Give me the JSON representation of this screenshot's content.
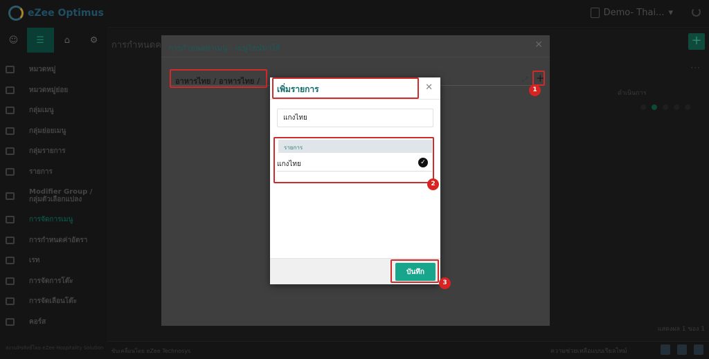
{
  "app": {
    "logo_text": "eZee Optimus"
  },
  "topbar": {
    "property_name": "Demo- Thai...",
    "caret": "▾"
  },
  "sidebar": {
    "items": [
      {
        "label": "หมวดหมู่"
      },
      {
        "label": "หมวดหมู่ย่อย"
      },
      {
        "label": "กลุ่มเมนู"
      },
      {
        "label": "กลุ่มย่อยเมนู"
      },
      {
        "label": "กลุ่มรายการ"
      },
      {
        "label": "รายการ"
      },
      {
        "label": "Modifier Group / กลุ่มตัวเลือกแปลง"
      },
      {
        "label": "การจัดการเมนู"
      },
      {
        "label": "การกำหนดค่าอัตรา"
      },
      {
        "label": "เรท"
      },
      {
        "label": "การจัดการโต๊ะ"
      },
      {
        "label": "การจัดเลือนโต๊ะ"
      },
      {
        "label": "คอร์ส"
      }
    ],
    "footer": "สงวนลิขสิทธิ์โดย eZee Hospitality Solution"
  },
  "background_page": {
    "title": "การกำหนดค",
    "actions_header": "ดำเนินการ",
    "pager": "แสดงผล 1 ของ 1"
  },
  "bottombar": {
    "powered": "ขับเคลื่อนโดย eZee Technosys",
    "new_features": "ความช่วยเหลือแบบเรียลไทม์"
  },
  "modal": {
    "title": "การกำหนดค่าเมนู - เมนูไซน์มาโต้",
    "breadcrumb": "อาหารไทย /  อาหารไทย /",
    "expand_icon": "⤢",
    "add_icon": "+"
  },
  "dialog": {
    "title": "เพิ่มรายการ",
    "close": "✕",
    "input_value": "แกงไทย",
    "list_header": "รายการ",
    "list_items": [
      {
        "label": "แกงไทย",
        "checked": true
      }
    ],
    "save_label": "บันทึก"
  },
  "badges": {
    "b1": "1",
    "b2": "2",
    "b3": "3"
  },
  "colors": {
    "accent": "#17a68c",
    "highlight": "#d02b2b",
    "badge": "#d92323"
  }
}
